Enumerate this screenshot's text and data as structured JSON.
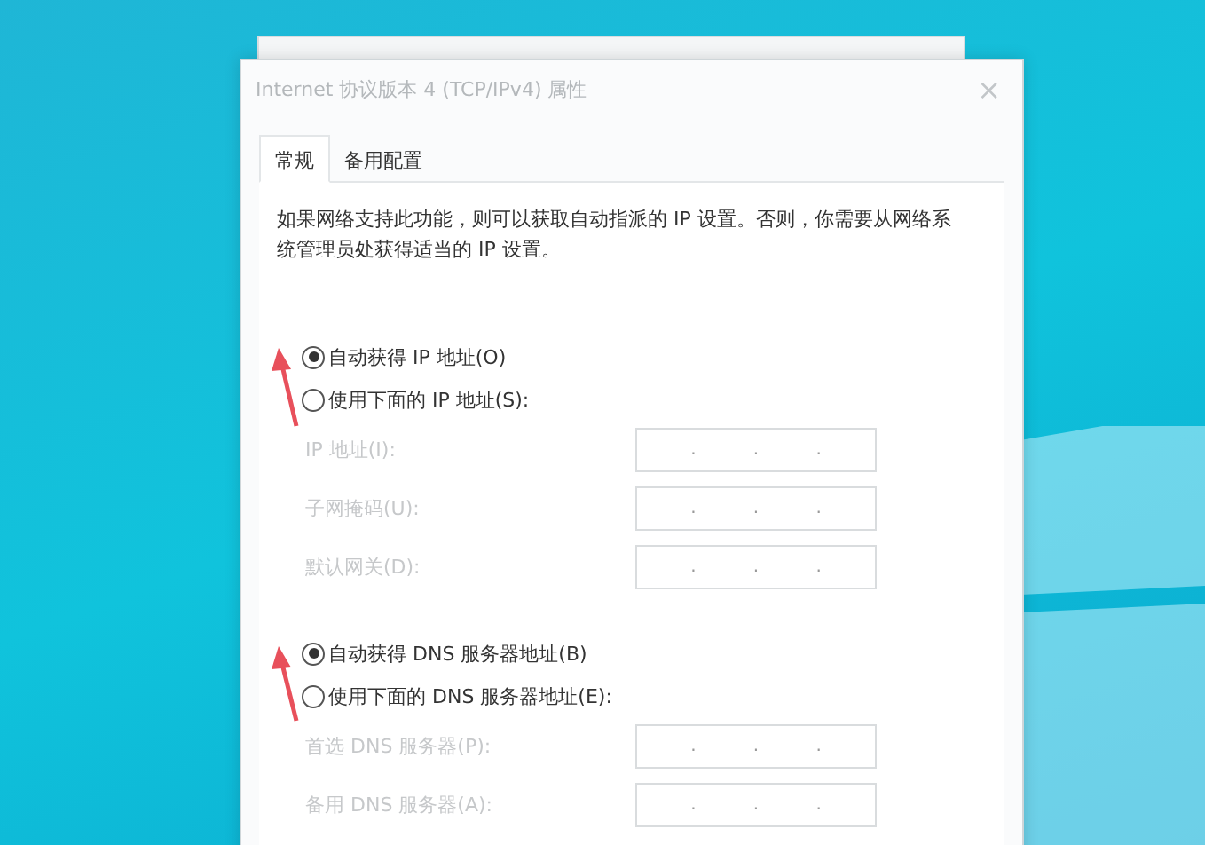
{
  "window": {
    "title": "Internet 协议版本 4 (TCP/IPv4) 属性",
    "close": "×"
  },
  "tabs": [
    {
      "label": "常规",
      "selected": true
    },
    {
      "label": "备用配置",
      "selected": false
    }
  ],
  "description": "如果网络支持此功能，则可以获取自动指派的 IP 设置。否则，你需要从网络系统管理员处获得适当的 IP 设置。",
  "sections": [
    {
      "options": [
        {
          "label": "自动获得 IP 地址(O)",
          "selected": true
        },
        {
          "label": "使用下面的 IP 地址(S):",
          "selected": false
        }
      ],
      "fields": [
        {
          "label": "IP 地址(I):",
          "disabled": true,
          "separators": [
            ".",
            ".",
            "."
          ]
        },
        {
          "label": "子网掩码(U):",
          "disabled": true,
          "separators": [
            ".",
            ".",
            "."
          ]
        },
        {
          "label": "默认网关(D):",
          "disabled": true,
          "separators": [
            ".",
            ".",
            "."
          ]
        }
      ]
    },
    {
      "options": [
        {
          "label": "自动获得 DNS 服务器地址(B)",
          "selected": true
        },
        {
          "label": "使用下面的 DNS 服务器地址(E):",
          "selected": false
        }
      ],
      "fields": [
        {
          "label": "首选 DNS 服务器(P):",
          "disabled": true,
          "separators": [
            ".",
            ".",
            "."
          ]
        },
        {
          "label": "备用 DNS 服务器(A):",
          "disabled": true,
          "separators": [
            ".",
            ".",
            "."
          ]
        }
      ]
    }
  ]
}
